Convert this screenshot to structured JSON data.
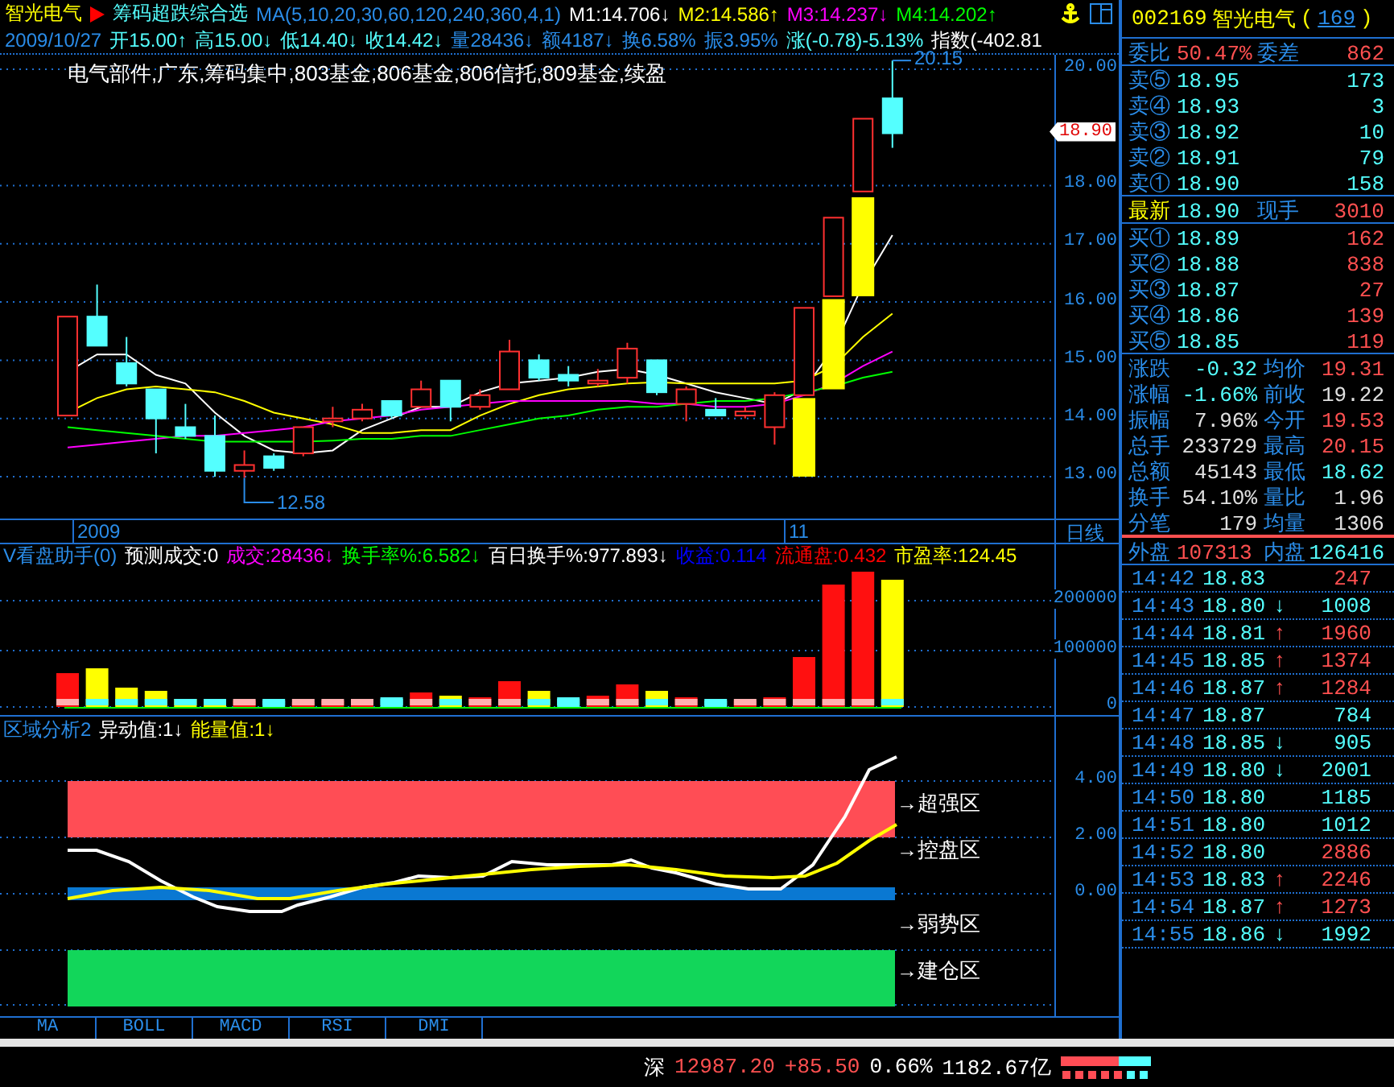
{
  "header": {
    "stock_name": "智光电气",
    "formula_name": "筹码超跌综合选",
    "ma_params": "MA(5,10,20,30,60,120,240,360,4,1)",
    "ma_values": [
      {
        "text": "M1:14.706↓",
        "color": "#ffffff"
      },
      {
        "text": "M2:14.586↑",
        "color": "#ffff00"
      },
      {
        "text": "M3:14.237↓",
        "color": "#ff00ff"
      },
      {
        "text": "M4:14.202↑",
        "color": "#00ff00"
      }
    ]
  },
  "bar_info": {
    "date": "2009/10/27",
    "items": [
      {
        "text": "开15.00↑",
        "color": "#54ffff"
      },
      {
        "text": "高15.00↓",
        "color": "#54ffff"
      },
      {
        "text": "低14.40↓",
        "color": "#54ffff"
      },
      {
        "text": "收14.42↓",
        "color": "#54ffff"
      },
      {
        "text": "量28436↓",
        "color": "#2a8ce8"
      },
      {
        "text": "额4187↓",
        "color": "#2a8ce8"
      },
      {
        "text": "换6.58%",
        "color": "#2a8ce8"
      },
      {
        "text": "振3.95%",
        "color": "#2a8ce8"
      },
      {
        "text": "涨(-0.78)-5.13%",
        "color": "#54ffff"
      },
      {
        "text": "指数(-402.81",
        "color": "#ffffff"
      }
    ]
  },
  "main_chart": {
    "info_line": "电气部件,广东,筹码集中,803基金,806基金,806信托,809基金,续盈",
    "high_label": "20.15",
    "low_label": "12.58",
    "current_price": "18.90",
    "price_ticks": [
      "20.00",
      "18.00",
      "17.00",
      "16.00",
      "15.00",
      "14.00",
      "13.00"
    ]
  },
  "date_axis": {
    "labels": [
      "2009",
      "11"
    ],
    "period": "日线"
  },
  "volume_panel": {
    "title": "V看盘助手(0)",
    "items": [
      {
        "text": "预测成交:0",
        "color": "#ffffff"
      },
      {
        "text": "成交:28436↓",
        "color": "#ff00ff"
      },
      {
        "text": "换手率%:6.582↓",
        "color": "#00ff00"
      },
      {
        "text": "百日换手%:977.893↓",
        "color": "#ffffff"
      },
      {
        "text": "收益:0.114",
        "color": "#0000ff"
      },
      {
        "text": "流通盘:0.432",
        "color": "#ff0000"
      },
      {
        "text": "市盈率:124.45",
        "color": "#ffff00"
      }
    ],
    "ticks": [
      "200000",
      "100000",
      "0"
    ]
  },
  "zone_panel": {
    "title": "区域分析2",
    "items": [
      {
        "text": "异动值:1↓",
        "color": "#ffffff"
      },
      {
        "text": "能量值:1↓",
        "color": "#ffff00"
      }
    ],
    "zones": [
      "→超强区",
      "→控盘区",
      "→弱势区",
      "→建仓区"
    ],
    "ticks": [
      "4.00",
      "2.00",
      "0.00"
    ]
  },
  "indicator_tabs": [
    "MA",
    "BOLL",
    "MACD",
    "RSI",
    "DMI"
  ],
  "quote": {
    "code": "002169",
    "name": "智光电气",
    "count_prefix": "(",
    "count": "169",
    "count_suffix": ")",
    "ratio_label": "委比",
    "ratio": "50.47%",
    "diff_label": "委差",
    "diff": "862",
    "asks": [
      {
        "label": "卖⑤",
        "price": "18.95",
        "volume": "173"
      },
      {
        "label": "卖④",
        "price": "18.93",
        "volume": "3"
      },
      {
        "label": "卖③",
        "price": "18.92",
        "volume": "10"
      },
      {
        "label": "卖②",
        "price": "18.91",
        "volume": "79"
      },
      {
        "label": "卖①",
        "price": "18.90",
        "volume": "158"
      }
    ],
    "latest": {
      "label": "最新",
      "price": "18.90",
      "volume_label": "现手",
      "volume": "3010"
    },
    "bids": [
      {
        "label": "买①",
        "price": "18.89",
        "volume": "162"
      },
      {
        "label": "买②",
        "price": "18.88",
        "volume": "838"
      },
      {
        "label": "买③",
        "price": "18.87",
        "volume": "27"
      },
      {
        "label": "买④",
        "price": "18.86",
        "volume": "139"
      },
      {
        "label": "买⑤",
        "price": "18.85",
        "volume": "119"
      }
    ],
    "stats": [
      {
        "left": {
          "label": "涨跌",
          "value": "-0.32",
          "color": "#54ffff"
        },
        "right": {
          "label": "均价",
          "value": "19.31",
          "color": "#ff5050"
        }
      },
      {
        "left": {
          "label": "涨幅",
          "value": "-1.66%",
          "color": "#54ffff"
        },
        "right": {
          "label": "前收",
          "value": "19.22",
          "color": "#e0e0e0"
        }
      },
      {
        "left": {
          "label": "振幅",
          "value": "7.96%",
          "color": "#e0e0e0"
        },
        "right": {
          "label": "今开",
          "value": "19.53",
          "color": "#ff5050"
        }
      },
      {
        "left": {
          "label": "总手",
          "value": "233729",
          "color": "#e0e0e0"
        },
        "right": {
          "label": "最高",
          "value": "20.15",
          "color": "#ff5050"
        }
      },
      {
        "left": {
          "label": "总额",
          "value": "45143",
          "color": "#e0e0e0"
        },
        "right": {
          "label": "最低",
          "value": "18.62",
          "color": "#54ffff"
        }
      },
      {
        "left": {
          "label": "换手",
          "value": "54.10%",
          "color": "#e0e0e0"
        },
        "right": {
          "label": "量比",
          "value": "1.96",
          "color": "#e0e0e0"
        }
      },
      {
        "left": {
          "label": "分笔",
          "value": "179",
          "color": "#e0e0e0"
        },
        "right": {
          "label": "均量",
          "value": "1306",
          "color": "#e0e0e0"
        }
      }
    ],
    "outer_label": "外盘",
    "outer": "107313",
    "inner_label": "内盘",
    "inner": "126416"
  },
  "trades": [
    {
      "time": "14:42",
      "price": "18.83",
      "volume": "247",
      "color": "#ff5050"
    },
    {
      "time": "14:43",
      "price": "18.80",
      "arrow": "↓",
      "volume": "1008",
      "color": "#54ffff"
    },
    {
      "time": "14:44",
      "price": "18.81",
      "arrow": "↑",
      "volume": "1960",
      "color": "#ff5050"
    },
    {
      "time": "14:45",
      "price": "18.85",
      "arrow": "↑",
      "volume": "1374",
      "color": "#ff5050"
    },
    {
      "time": "14:46",
      "price": "18.87",
      "arrow": "↑",
      "volume": "1284",
      "color": "#ff5050"
    },
    {
      "time": "14:47",
      "price": "18.87",
      "volume": "784",
      "color": "#54ffff"
    },
    {
      "time": "14:48",
      "price": "18.85",
      "arrow": "↓",
      "volume": "905",
      "color": "#54ffff"
    },
    {
      "time": "14:49",
      "price": "18.80",
      "arrow": "↓",
      "volume": "2001",
      "color": "#54ffff"
    },
    {
      "time": "14:50",
      "price": "18.80",
      "volume": "1185",
      "color": "#54ffff"
    },
    {
      "time": "14:51",
      "price": "18.80",
      "volume": "1012",
      "color": "#54ffff"
    },
    {
      "time": "14:52",
      "price": "18.80",
      "volume": "2886",
      "color": "#ff5050"
    },
    {
      "time": "14:53",
      "price": "18.83",
      "arrow": "↑",
      "volume": "2246",
      "color": "#ff5050"
    },
    {
      "time": "14:54",
      "price": "18.87",
      "arrow": "↑",
      "volume": "1273",
      "color": "#ff5050"
    },
    {
      "time": "14:55",
      "price": "18.86",
      "arrow": "↓",
      "volume": "1992",
      "color": "#54ffff"
    }
  ],
  "status_bar": {
    "market": "深",
    "index": "12987.20",
    "change": "+85.50",
    "percent": "0.66%",
    "turnover": "1182.67亿"
  }
}
